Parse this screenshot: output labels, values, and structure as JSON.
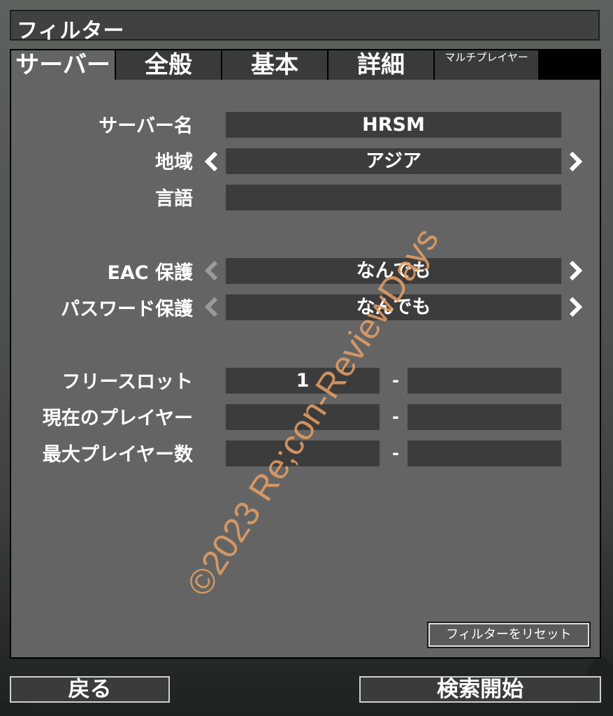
{
  "window": {
    "title": "フィルター"
  },
  "tabs": [
    {
      "label": "サーバー",
      "active": true
    },
    {
      "label": "全般",
      "active": false
    },
    {
      "label": "基本",
      "active": false
    },
    {
      "label": "詳細",
      "active": false
    },
    {
      "label": "マルチプレイヤー",
      "active": false
    }
  ],
  "server": {
    "server_name": {
      "label": "サーバー名",
      "value": "HRSM"
    },
    "region": {
      "label": "地域",
      "value": "アジア"
    },
    "language": {
      "label": "言語",
      "value": ""
    },
    "eac": {
      "label": "EAC 保護",
      "value": "なんでも"
    },
    "password": {
      "label": "パスワード保護",
      "value": "なんでも"
    },
    "free_slots": {
      "label": "フリースロット",
      "min": "1",
      "max": "",
      "separator": "-"
    },
    "current_players": {
      "label": "現在のプレイヤー",
      "min": "",
      "max": "",
      "separator": "-"
    },
    "max_players": {
      "label": "最大プレイヤー数",
      "min": "",
      "max": "",
      "separator": "-"
    }
  },
  "reset_label": "フィルターをリセット",
  "footer": {
    "back_label": "戻る",
    "search_label": "検索開始"
  },
  "watermark": "©2023 Re;con-ReviewDays",
  "colors": {
    "panel": "#646464",
    "field": "#3c3c3c",
    "tab_inactive": "#3a3a3a",
    "watermark": "#e8a064"
  }
}
